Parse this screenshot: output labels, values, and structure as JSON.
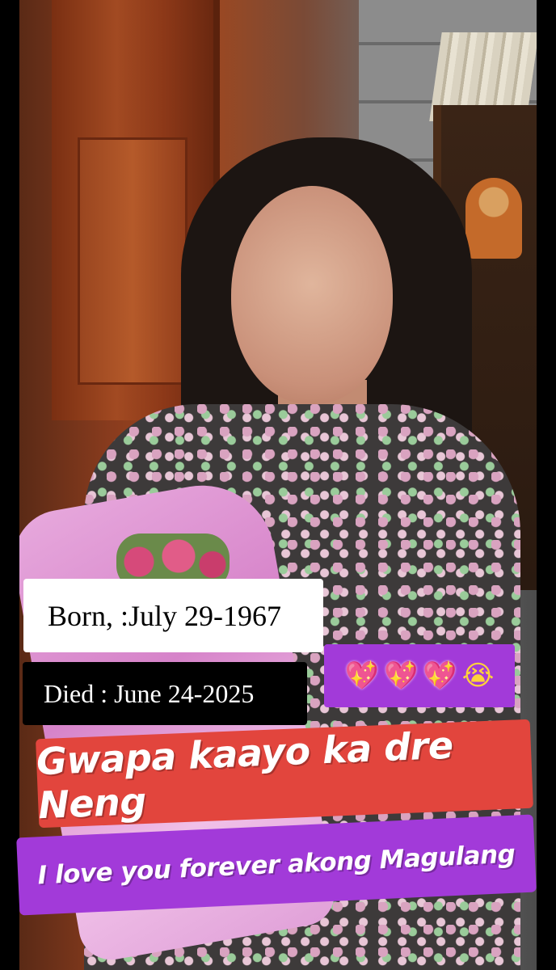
{
  "memorial": {
    "born": "Born, :July 29-1967",
    "died": "Died : June 24-2025",
    "emojis": [
      "💖",
      "💖",
      "💖",
      "😭"
    ],
    "title": "Gwapa kaayo ka dre Neng",
    "message": "I love you forever akong Magulang"
  },
  "colors": {
    "born_bg": "#ffffff",
    "died_bg": "#000000",
    "emoji_bg": "#a23ad9",
    "title_bg": "#e2453d",
    "message_bg": "#a23ad9"
  }
}
